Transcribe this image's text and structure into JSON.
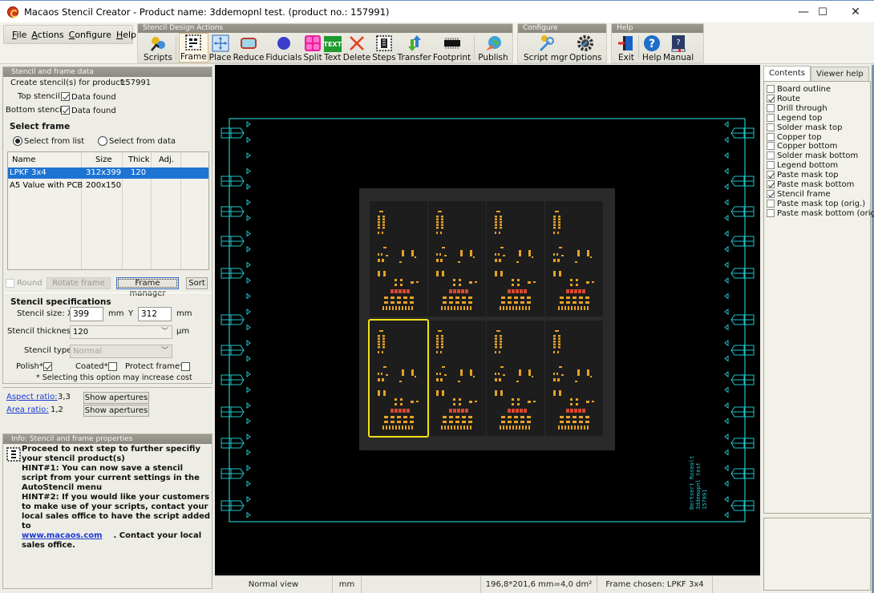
{
  "window": {
    "title": "Macaos Stencil Creator - Product name: 3ddemopnl test. (product no.: 157991)",
    "controls": {
      "minimize": "—",
      "maximize": "☐",
      "close": "✕"
    }
  },
  "menu": {
    "items": [
      {
        "label": "File",
        "accel": "F"
      },
      {
        "label": "Actions",
        "accel": "A"
      },
      {
        "label": "Configure",
        "accel": "C"
      },
      {
        "label": "Help",
        "accel": "H"
      }
    ]
  },
  "toolbars": {
    "design": {
      "title": "Stencil Design Actions",
      "buttons": [
        {
          "label": "Scripts",
          "icon": "scripts-gear-icon"
        },
        {
          "label": "Frame",
          "icon": "frame-icon",
          "active": true
        },
        {
          "label": "Place",
          "icon": "place-move-icon"
        },
        {
          "label": "Reduce",
          "icon": "reduce-icon"
        },
        {
          "label": "Fiducials",
          "icon": "fiducial-dot-icon"
        },
        {
          "label": "Split",
          "icon": "split-icon"
        },
        {
          "label": "Text",
          "icon": "text-icon",
          "icon_text": "TEXT"
        },
        {
          "label": "Delete",
          "icon": "delete-x-icon"
        },
        {
          "label": "Steps",
          "icon": "steps-icon"
        },
        {
          "label": "Transfer",
          "icon": "transfer-arrows-icon"
        },
        {
          "label": "Footprint",
          "icon": "footprint-chip-icon"
        },
        {
          "label": "Publish",
          "icon": "publish-globe-icon"
        }
      ]
    },
    "configure": {
      "title": "Configure",
      "buttons": [
        {
          "label": "Script mgr",
          "icon": "script-manager-icon"
        },
        {
          "label": "Options",
          "icon": "options-gear-icon"
        }
      ]
    },
    "help": {
      "title": "Help",
      "buttons": [
        {
          "label": "Exit",
          "icon": "exit-door-icon"
        },
        {
          "label": "Help",
          "icon": "help-question-icon"
        },
        {
          "label": "Manual",
          "icon": "manual-book-icon"
        }
      ]
    }
  },
  "left": {
    "frame_section": {
      "header": "Stencil and frame data",
      "create_label": "Create stencil(s) for product:",
      "product_no": "157991",
      "top_stencil_label": "Top stencil",
      "top_stencil_value": "Data found",
      "top_checked": true,
      "bottom_stencil_label": "Bottom stencil",
      "bottom_stencil_value": "Data found",
      "bottom_checked": true,
      "select_frame_title": "Select frame",
      "radio_list": "Select from list",
      "radio_data": "Select from data",
      "radio_selected": "list",
      "table": {
        "columns": [
          "Name",
          "Size",
          "Thick",
          "Adj."
        ],
        "rows": [
          {
            "name": "LPKF 3x4",
            "size": "312x399",
            "thick": "120",
            "adj": "",
            "selected": true
          },
          {
            "name": "A5 Value with PCB",
            "size": "200x150",
            "thick": "",
            "adj": "",
            "selected": false
          }
        ]
      },
      "round_label": "Round",
      "round_checked": false,
      "rotate_frame": "Rotate frame",
      "frame_manager": "Frame manager",
      "sort": "Sort"
    },
    "specs": {
      "title": "Stencil specifications",
      "size_label": "Stencil size: X",
      "size_x": "399",
      "unit_mm": "mm",
      "y_label": "Y",
      "size_y": "312",
      "thickness_label": "Stencil thickness",
      "thickness_value": "120",
      "thickness_unit": "µm",
      "type_label": "Stencil type",
      "type_value": "Normal",
      "polish_label": "Polish*",
      "polish_checked": true,
      "coated_label": "Coated*",
      "coated_checked": false,
      "protect_label": "Protect frame*",
      "protect_checked": false,
      "note": "* Selecting this option may increase cost"
    },
    "ratios": {
      "aspect_label": "Aspect ratio:",
      "aspect_value": "3,3",
      "area_label": "Area ratio:",
      "area_value": "1,2",
      "show_apertures": "Show apertures"
    },
    "info": {
      "header": "Info: Stencil and frame properties",
      "line1": "Proceed to next step to further specifiy your stencil product(s)",
      "hint1": "HINT#1: You can now save a stencil script from your current settings in the AutoStencil menu",
      "hint2": "HINT#2: If you would like your customers to make use of your scripts, contact your local sales office to have the script added to",
      "link": "www.macaos.com",
      "tail": ". Contact your local sales office."
    }
  },
  "canvas": {
    "panel_grid": {
      "rows": 2,
      "cols": 4,
      "selected": {
        "row": 1,
        "col": 0
      }
    },
    "frame_text": [
      "Bertsert Rosealt",
      "3ddemopnl test",
      "157991"
    ],
    "colors": {
      "frame": "#22c4c9",
      "pads": "#e6a226",
      "pads_alt": "#d9472e",
      "panel_bg": "#2a2a2a",
      "board": "#1d1d1d",
      "selection": "#f1e216"
    }
  },
  "status": {
    "view": "Normal view",
    "unit": "mm",
    "empty": "",
    "area": "196,8*201,6 mm=4,0 dm²",
    "frame": "Frame chosen: LPKF 3x4"
  },
  "right": {
    "tabs": [
      {
        "label": "Contents",
        "active": true
      },
      {
        "label": "Viewer help",
        "active": false
      }
    ],
    "layers": [
      {
        "label": "Board outline",
        "checked": false
      },
      {
        "label": "Route",
        "checked": true
      },
      {
        "label": "Drill through",
        "checked": false
      },
      {
        "label": "Legend top",
        "checked": false
      },
      {
        "label": "Solder mask top",
        "checked": false
      },
      {
        "label": "Copper top",
        "checked": false
      },
      {
        "label": "Copper bottom",
        "checked": false
      },
      {
        "label": "Solder mask bottom",
        "checked": false
      },
      {
        "label": "Legend bottom",
        "checked": false
      },
      {
        "label": "Paste mask top",
        "checked": true
      },
      {
        "label": "Paste mask bottom",
        "checked": true
      },
      {
        "label": "Stencil frame",
        "checked": true
      },
      {
        "label": "Paste mask top (orig.)",
        "checked": false
      },
      {
        "label": "Paste mask bottom (orig.)",
        "checked": false
      }
    ]
  }
}
